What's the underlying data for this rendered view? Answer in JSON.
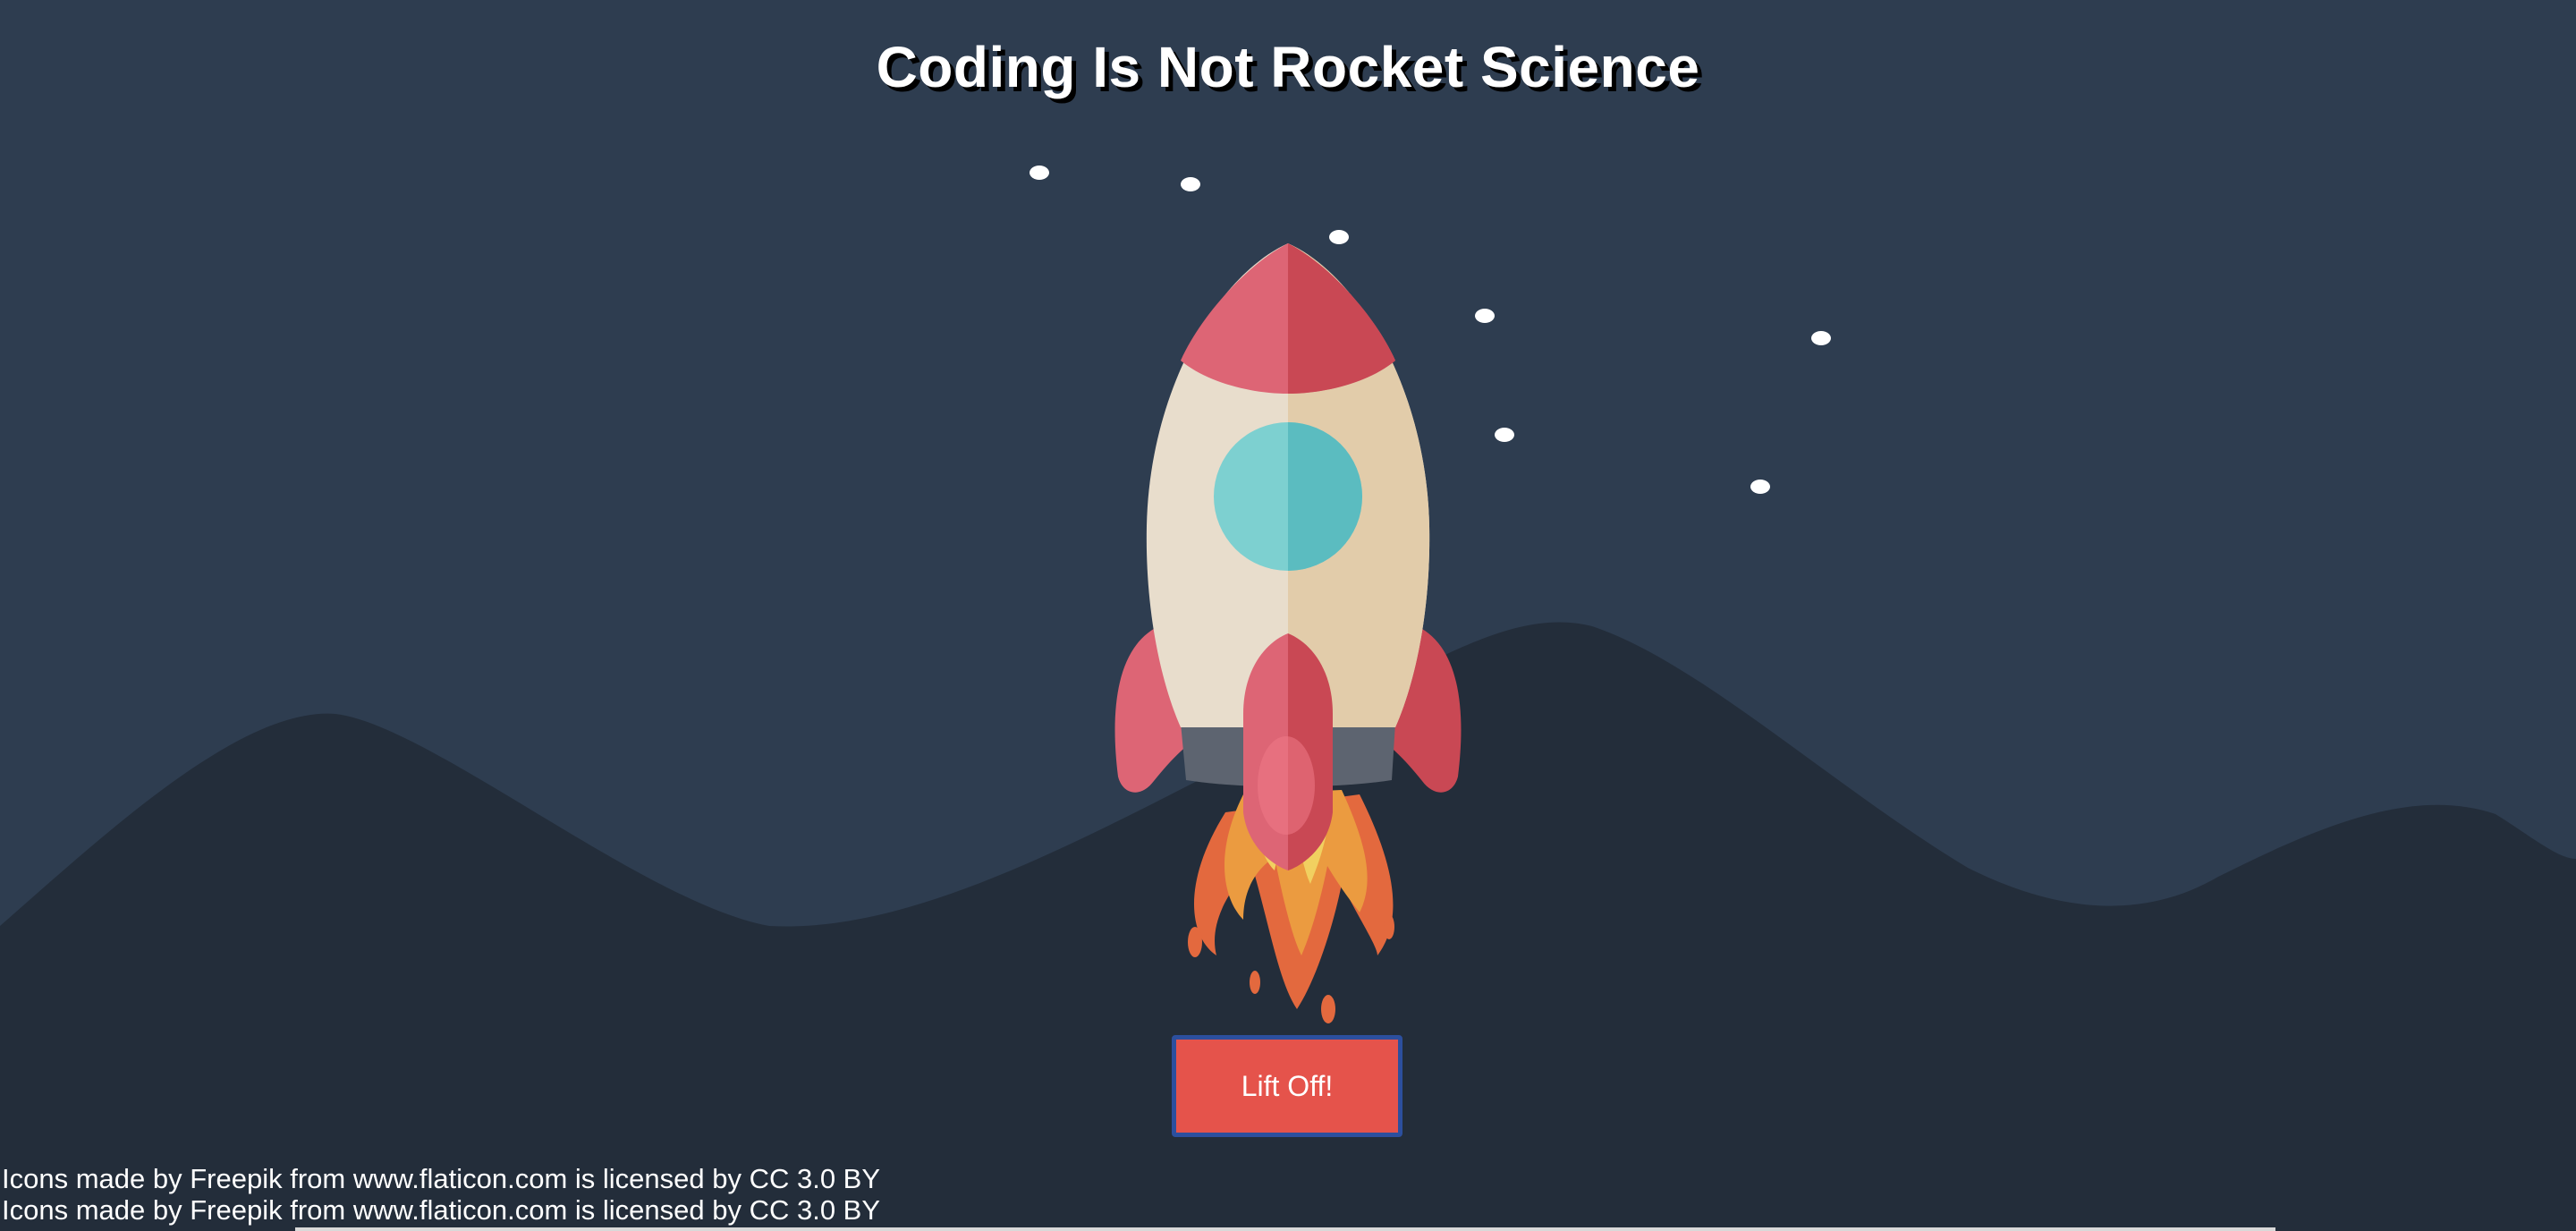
{
  "page": {
    "title": "Coding Is Not Rocket Science"
  },
  "controls": {
    "launch_label": "Lift Off!"
  },
  "footer": {
    "credits": [
      "Icons made by Freepik from www.flaticon.com is licensed by CC 3.0 BY",
      "Icons made by Freepik from www.flaticon.com is licensed by CC 3.0 BY"
    ]
  },
  "colors": {
    "sky": "#2e3d50",
    "mountains": "#232d3a",
    "button": "#e5534b",
    "button_border": "#2c4f9e",
    "rocket_red": "#dd6575",
    "rocket_body": "#e8ddcc",
    "window": "#6fcbcd",
    "flame": "#e8923d"
  },
  "icons": [
    "rocket-icon",
    "star-icon"
  ]
}
